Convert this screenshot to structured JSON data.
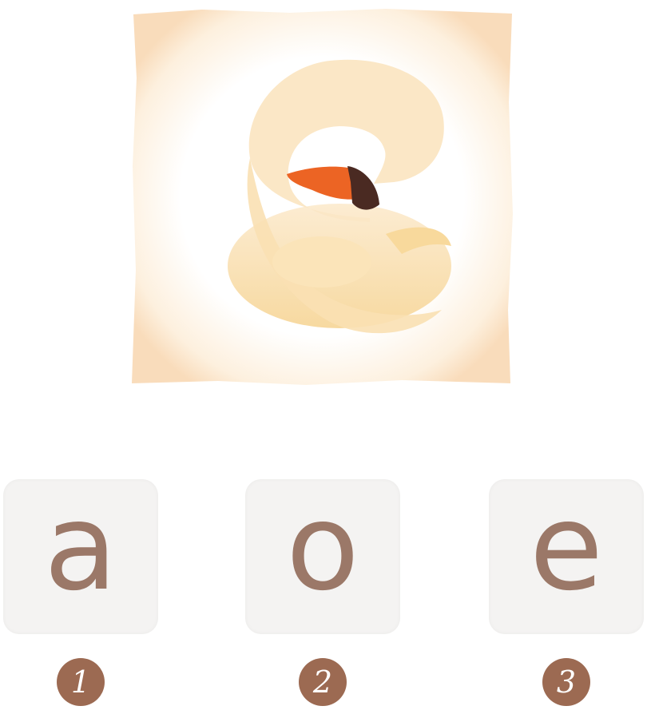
{
  "picture": {
    "icon": "swan-letter-e",
    "colors": {
      "frame": "#fde9cf",
      "swan_body": "#fbe0ad",
      "beak": "#ec6424",
      "beak_tip": "#4a2a22"
    }
  },
  "options": [
    {
      "letter": "a",
      "number": "1"
    },
    {
      "letter": "o",
      "number": "2"
    },
    {
      "letter": "e",
      "number": "3"
    }
  ],
  "colors": {
    "letter": "#9b7868",
    "badge": "#9c6a52",
    "tile": "#f4f3f2"
  }
}
